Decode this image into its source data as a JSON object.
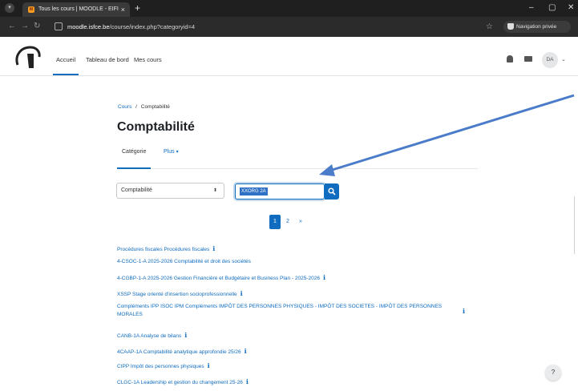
{
  "browser": {
    "tab_title": "Tous les cours | MOODLE - EIFI",
    "tab_close": "×",
    "new_tab": "+",
    "url_host": "moodle.isfce.be",
    "url_path": "/course/index.php?categoryid=4",
    "private_label": "Navigation privée",
    "minimize": "–",
    "maximize": "▢",
    "close": "✕"
  },
  "navbar": {
    "links": [
      "Accueil",
      "Tableau de bord",
      "Mes cours"
    ],
    "active_link": "Accueil",
    "user_initials": "DA"
  },
  "breadcrumb": {
    "root": "Cours",
    "separator": "/",
    "current": "Comptabilité"
  },
  "page_title": "Comptabilité",
  "subnav": {
    "tabs": [
      "Catégorie",
      "Plus"
    ],
    "more_arrow": "▾"
  },
  "filters": {
    "category_select": "Comptabilité",
    "search_value": "XXORG 2A"
  },
  "pagination": {
    "pages": [
      "1",
      "2",
      "»"
    ],
    "current": "1"
  },
  "courses": [
    {
      "title": "Procédures fiscales Procédures fiscales",
      "info": true
    },
    {
      "title": "4-CSOC-1-A 2025-2026 Comptabilité et droit des sociétés",
      "info": false
    },
    {
      "title": "4-CGBP-1-A 2025-2026 Gestion Financière et Budgétaire et Business Plan - 2025-2026",
      "info": true
    },
    {
      "title": "XSSP Stage orienté d'insertion socioprofessionnelle",
      "info": true
    },
    {
      "title": "Compléments IPP ISOC IPM Compléments IMPÔT DES PERSONNES PHYSIQUES - IMPÔT DES SOCIETES - IMPÔT DES PERSONNES MORALES",
      "info": true
    },
    {
      "title": "CANB-1A Analyse de bilans",
      "info": true
    },
    {
      "title": "4CAAP-1A Comptabilité analytique approfondie 25/26",
      "info": true
    },
    {
      "title": "CIPP Impôt des personnes physiques",
      "info": true
    },
    {
      "title": "CLGC-1A Leadership et gestion du changement 25-26",
      "info": true
    }
  ],
  "info_glyph": "ℹ",
  "help_label": "?",
  "colors": {
    "accent": "#0f6cbf",
    "annotation_arrow": "#4a7cc9",
    "chrome_dark": "#1f1f1f"
  }
}
